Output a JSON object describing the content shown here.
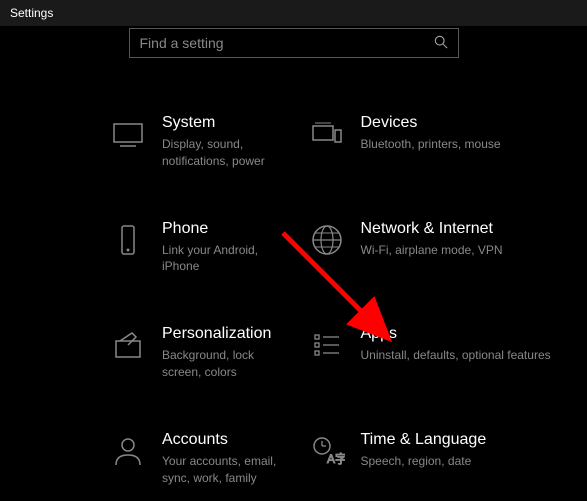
{
  "window": {
    "title": "Settings"
  },
  "search": {
    "placeholder": "Find a setting"
  },
  "tiles": [
    {
      "title": "System",
      "sub": "Display, sound, notifications, power"
    },
    {
      "title": "Devices",
      "sub": "Bluetooth, printers, mouse"
    },
    {
      "title": "Phone",
      "sub": "Link your Android, iPhone"
    },
    {
      "title": "Network & Internet",
      "sub": "Wi-Fi, airplane mode, VPN"
    },
    {
      "title": "Personalization",
      "sub": "Background, lock screen, colors"
    },
    {
      "title": "Apps",
      "sub": "Uninstall, defaults, optional features"
    },
    {
      "title": "Accounts",
      "sub": "Your accounts, email, sync, work, family"
    },
    {
      "title": "Time & Language",
      "sub": "Speech, region, date"
    }
  ],
  "annotation": {
    "arrow_color": "#ff0000"
  }
}
